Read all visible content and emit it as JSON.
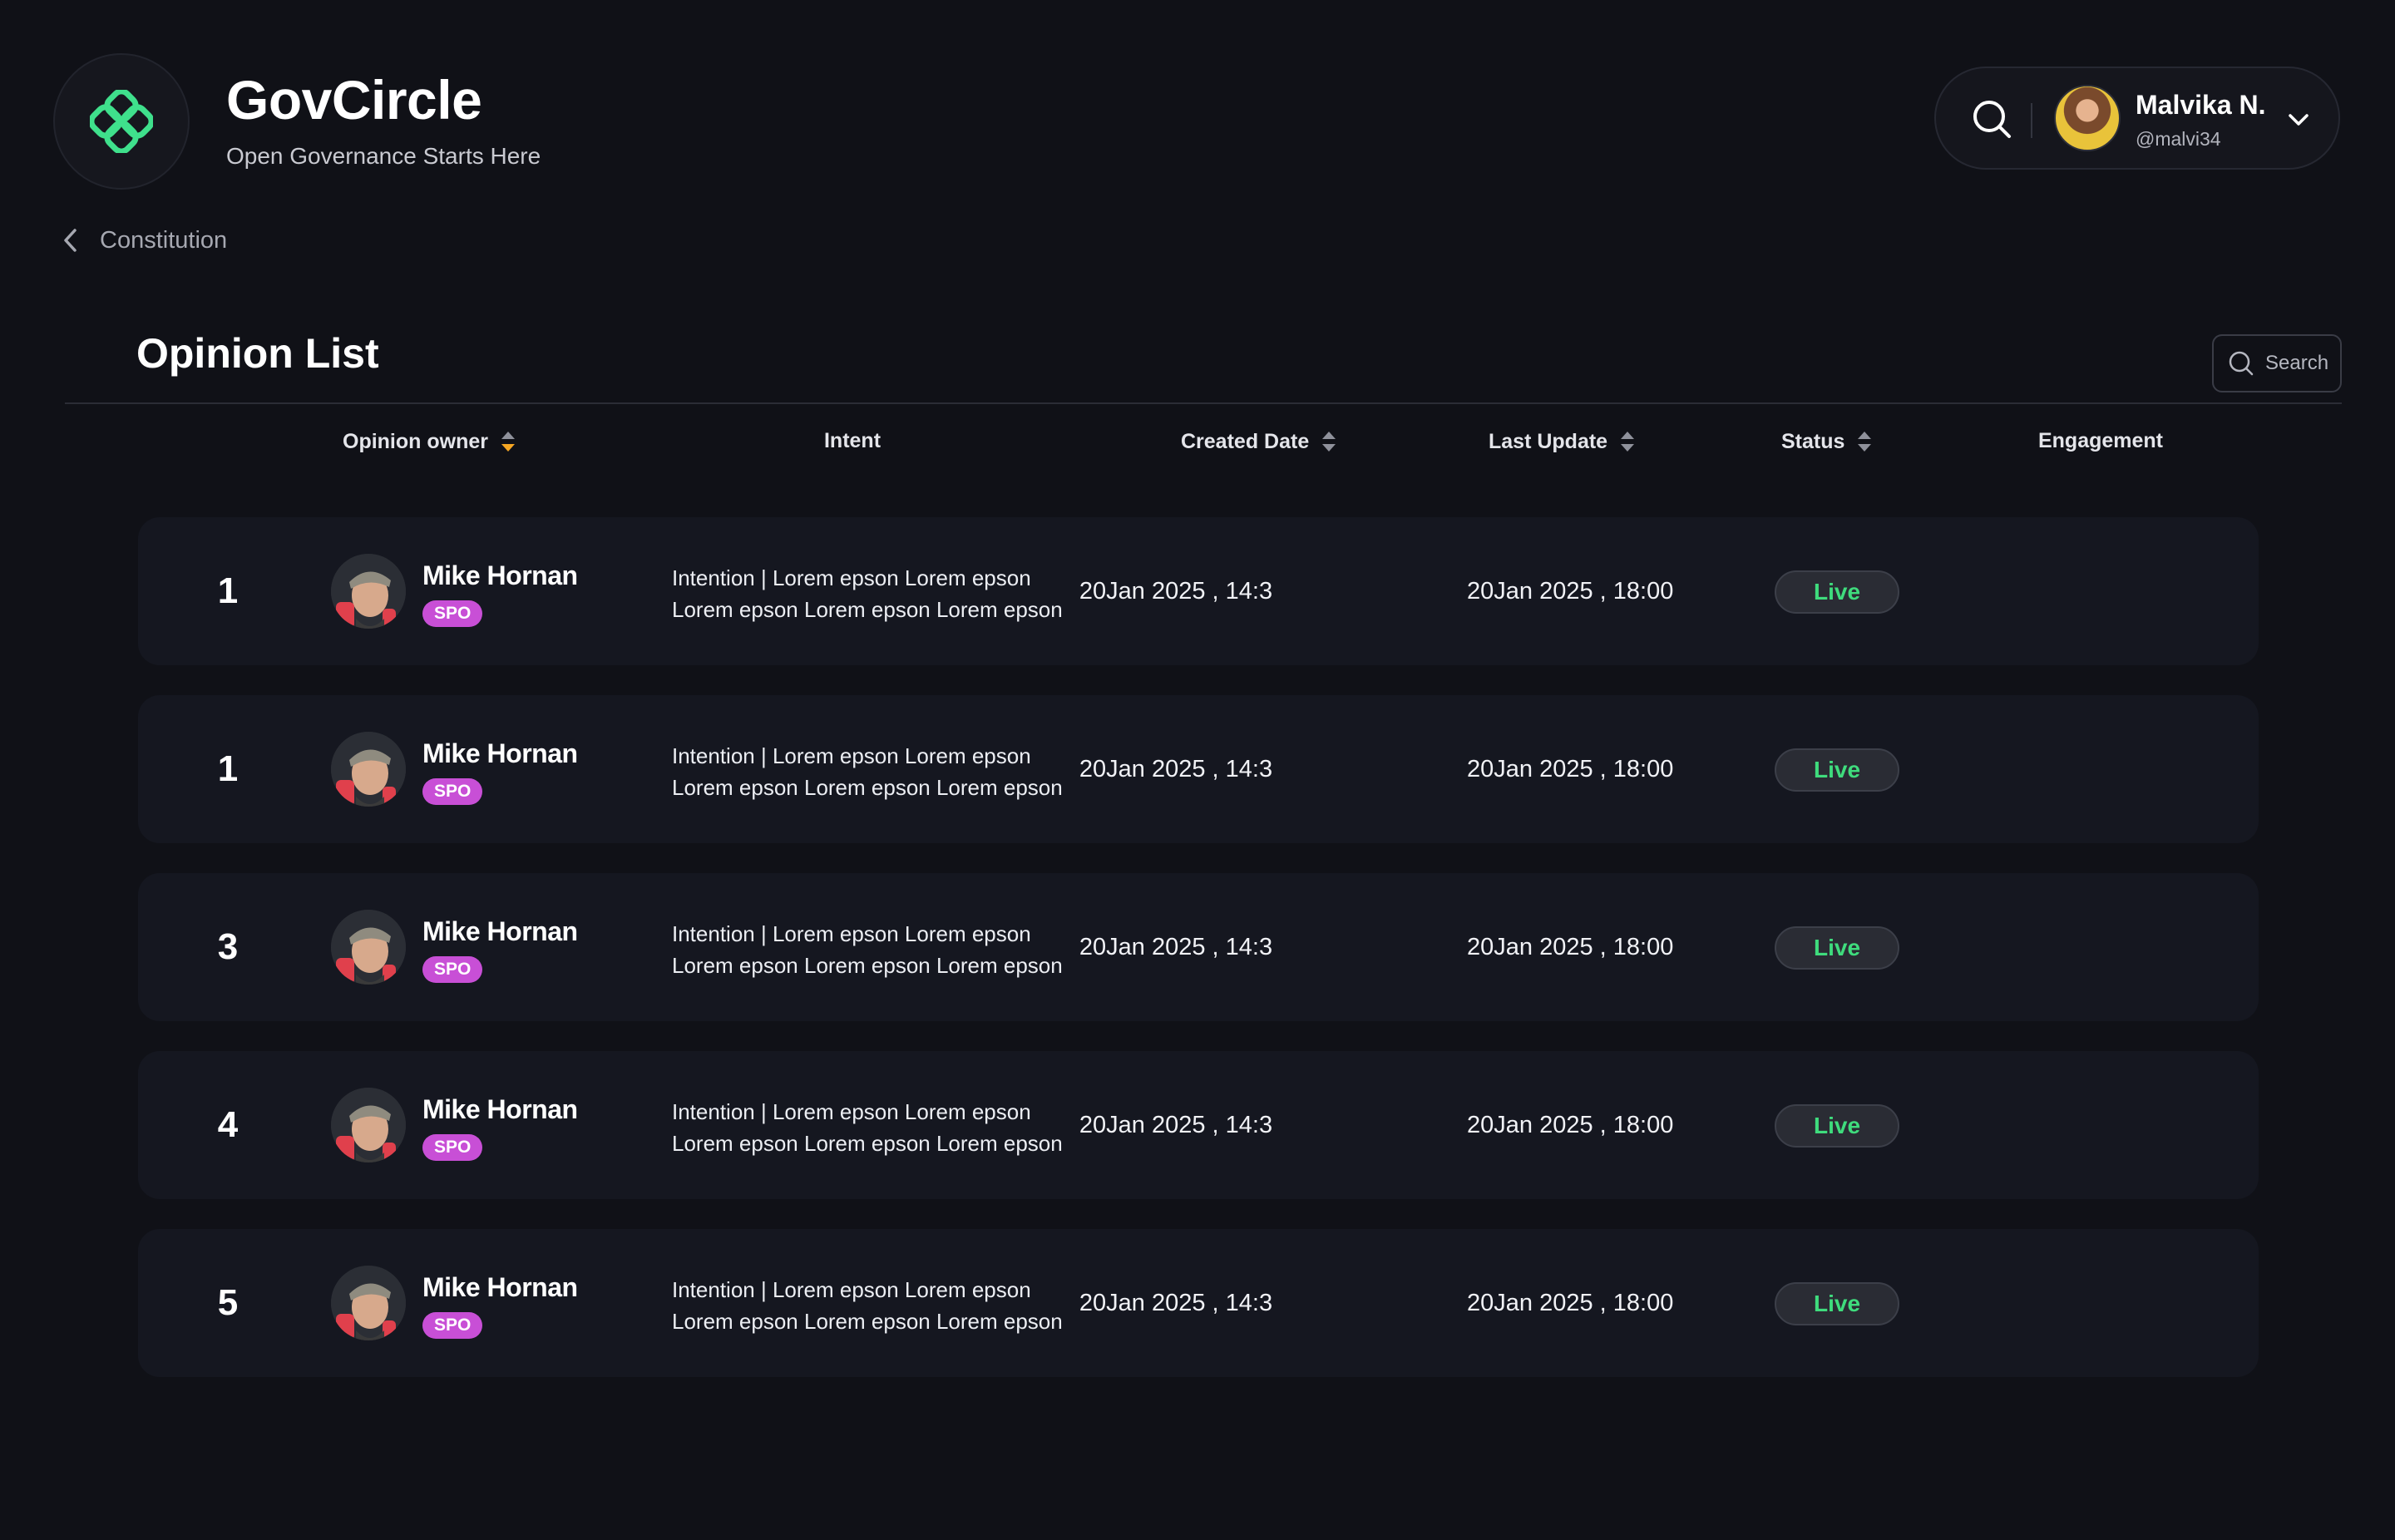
{
  "app": {
    "title": "GovCircle",
    "subtitle": "Open Governance Starts Here",
    "accent_color": "#3fe08c",
    "logo_icon": "clover-knot-icon"
  },
  "user": {
    "name": "Malvika N.",
    "handle": "@malvi34",
    "search_icon": "search-icon",
    "menu_icon": "chevron-down-icon"
  },
  "breadcrumb": {
    "back_icon": "chevron-left-icon",
    "label": "Constitution"
  },
  "section": {
    "title": "Opinion List",
    "search_placeholder": "Search"
  },
  "table": {
    "columns": {
      "owner": "Opinion owner",
      "intent": "Intent",
      "created": "Created Date",
      "updated": "Last Update",
      "status": "Status",
      "engagement": "Engagement"
    },
    "rows": [
      {
        "num": "1",
        "name": "Mike Hornan",
        "badge": "SPO",
        "intent_line1": "Intention | Lorem epson Lorem epson",
        "intent_line2": "Lorem epson Lorem epson Lorem epson",
        "created": "20Jan 2025 , 14:3",
        "updated": "20Jan 2025 , 18:00",
        "status": "Live"
      },
      {
        "num": "1",
        "name": "Mike Hornan",
        "badge": "SPO",
        "intent_line1": "Intention | Lorem epson Lorem epson",
        "intent_line2": "Lorem epson Lorem epson Lorem epson",
        "created": "20Jan 2025 , 14:3",
        "updated": "20Jan 2025 , 18:00",
        "status": "Live"
      },
      {
        "num": "3",
        "name": "Mike Hornan",
        "badge": "SPO",
        "intent_line1": "Intention | Lorem epson Lorem epson",
        "intent_line2": "Lorem epson Lorem epson Lorem epson",
        "created": "20Jan 2025 , 14:3",
        "updated": "20Jan 2025 , 18:00",
        "status": "Live"
      },
      {
        "num": "4",
        "name": "Mike Hornan",
        "badge": "SPO",
        "intent_line1": "Intention | Lorem epson Lorem epson",
        "intent_line2": "Lorem epson Lorem epson Lorem epson",
        "created": "20Jan 2025 , 14:3",
        "updated": "20Jan 2025 , 18:00",
        "status": "Live"
      },
      {
        "num": "5",
        "name": "Mike Hornan",
        "badge": "SPO",
        "intent_line1": "Intention | Lorem epson Lorem epson",
        "intent_line2": "Lorem epson Lorem epson Lorem epson",
        "created": "20Jan 2025 , 14:3",
        "updated": "20Jan 2025 , 18:00",
        "status": "Live"
      }
    ]
  },
  "colors": {
    "background": "#101117",
    "row_background": "#151720",
    "badge": "#c84fd6",
    "status_live": "#3fdc7d",
    "sort_active": "#f5a623"
  }
}
